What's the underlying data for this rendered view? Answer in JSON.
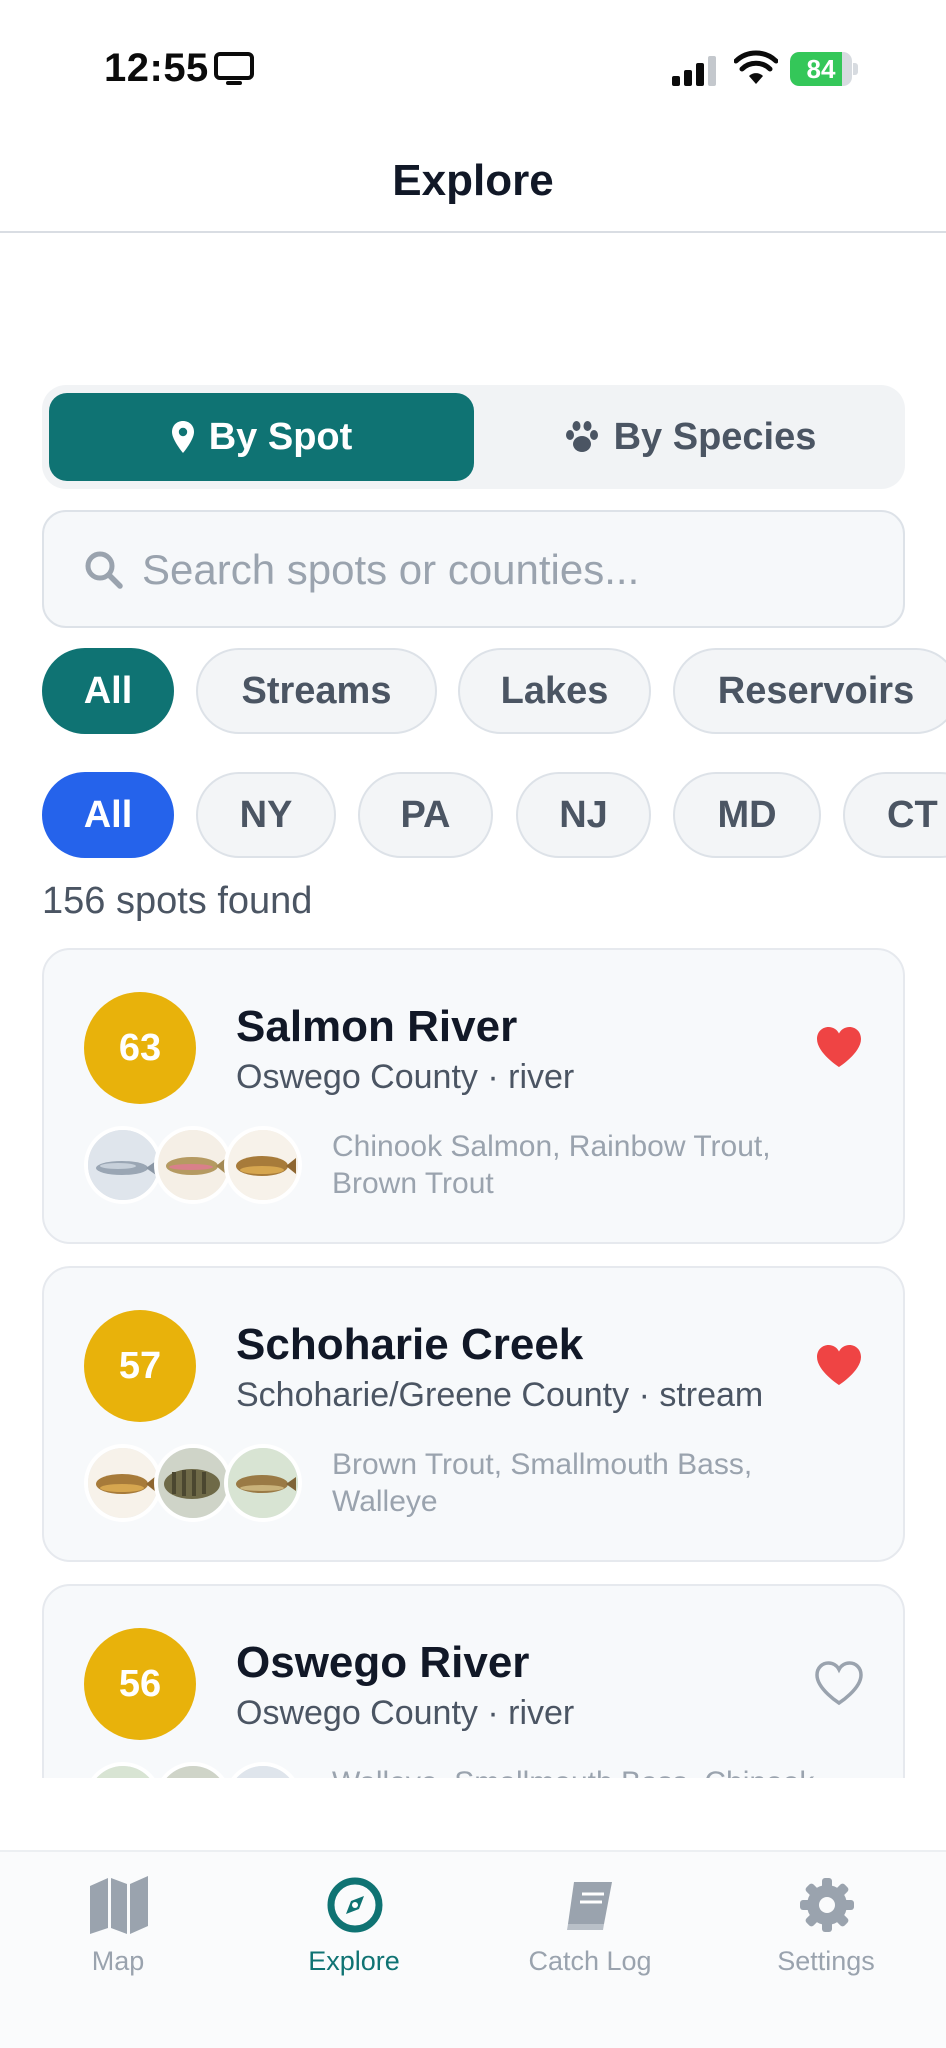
{
  "status_bar": {
    "time": "12:55",
    "battery_percent": 84,
    "battery_label": "84"
  },
  "header": {
    "title": "Explore"
  },
  "segmented": {
    "by_spot_label": "By Spot",
    "by_species_label": "By Species",
    "selected": "by_spot"
  },
  "search": {
    "placeholder": "Search spots or counties...",
    "value": ""
  },
  "type_filters": [
    "All",
    "Streams",
    "Lakes",
    "Reservoirs"
  ],
  "state_filters": [
    "All",
    "NY",
    "PA",
    "NJ",
    "MD",
    "CT"
  ],
  "results": {
    "count_label": "156 spots found"
  },
  "spots": [
    {
      "score": "63",
      "name": "Salmon River",
      "meta": "Oswego County · river",
      "species": "Chinook Salmon, Rainbow Trout, Brown Trout",
      "favorite": true
    },
    {
      "score": "57",
      "name": "Schoharie Creek",
      "meta": "Schoharie/Greene County · stream",
      "species": "Brown Trout, Smallmouth Bass, Walleye",
      "favorite": true
    },
    {
      "score": "56",
      "name": "Oswego River",
      "meta": "Oswego County · river",
      "species": "Walleye, Smallmouth Bass, Chinook",
      "favorite": false
    }
  ],
  "tabs": {
    "map": "Map",
    "explore": "Explore",
    "catch_log": "Catch Log",
    "settings": "Settings",
    "active": "explore"
  },
  "colors": {
    "accent_teal": "#0f7373",
    "accent_blue": "#2563eb",
    "score_gold": "#e8b20b",
    "favorite_red": "#ef4444"
  },
  "icons": {
    "by_spot": "map-pin-icon",
    "by_species": "paw-icon",
    "search": "search-icon",
    "favorite": "heart-icon",
    "map_tab": "map-icon",
    "explore_tab": "compass-icon",
    "catch_log_tab": "book-icon",
    "settings_tab": "gear-icon"
  }
}
